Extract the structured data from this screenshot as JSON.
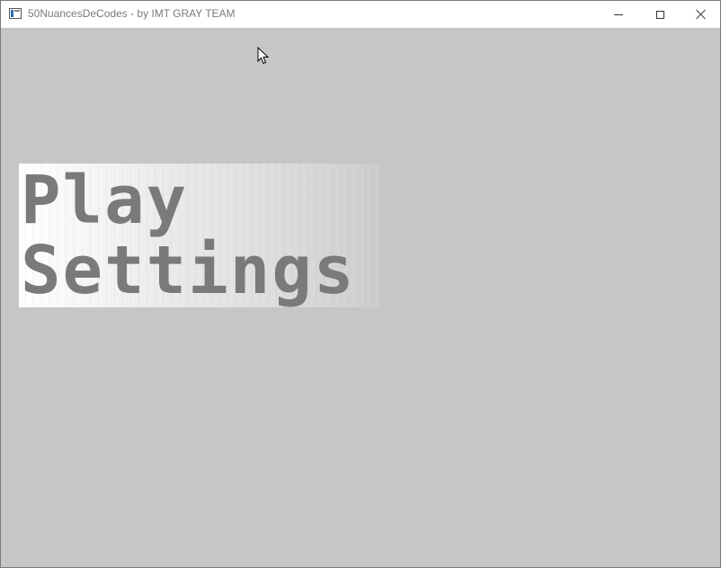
{
  "window": {
    "title": "50NuancesDeCodes - by IMT GRAY TEAM",
    "icon": "app-window-icon",
    "controls": {
      "minimize_icon": "minimize-icon",
      "maximize_icon": "maximize-icon",
      "close_icon": "close-icon"
    }
  },
  "menu": {
    "items": [
      {
        "label": "Play"
      },
      {
        "label": "Settings"
      }
    ],
    "text_color": "#7a7a7a"
  },
  "colors": {
    "background": "#c6c6c6",
    "titlebar": "#ffffff"
  },
  "cursor": {
    "icon": "mouse-pointer-icon"
  }
}
